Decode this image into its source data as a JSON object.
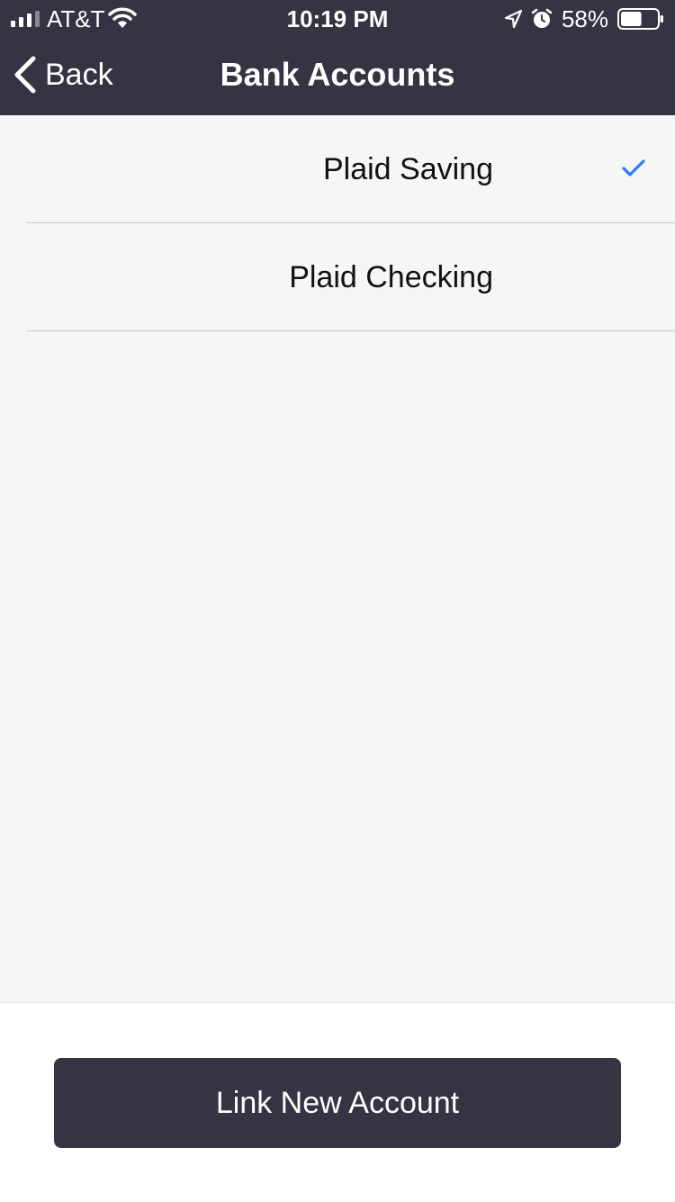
{
  "status_bar": {
    "carrier": "AT&T",
    "time": "10:19 PM",
    "battery_percent": "58%",
    "signal_icon": "signal-bars-icon",
    "wifi_icon": "wifi-icon",
    "location_icon": "location-arrow-icon",
    "alarm_icon": "alarm-clock-icon",
    "battery_icon": "battery-icon",
    "battery_level": 0.58
  },
  "nav": {
    "back_label": "Back",
    "back_icon": "chevron-left-icon",
    "title": "Bank Accounts"
  },
  "accounts": [
    {
      "label": "Plaid Saving",
      "selected": true
    },
    {
      "label": "Plaid Checking",
      "selected": false
    }
  ],
  "selection_icon": "checkmark-icon",
  "footer": {
    "button_label": "Link New Account"
  },
  "colors": {
    "bar_background": "#363343",
    "accent": "#2d7cf6",
    "page_background": "#f6f6f6"
  }
}
